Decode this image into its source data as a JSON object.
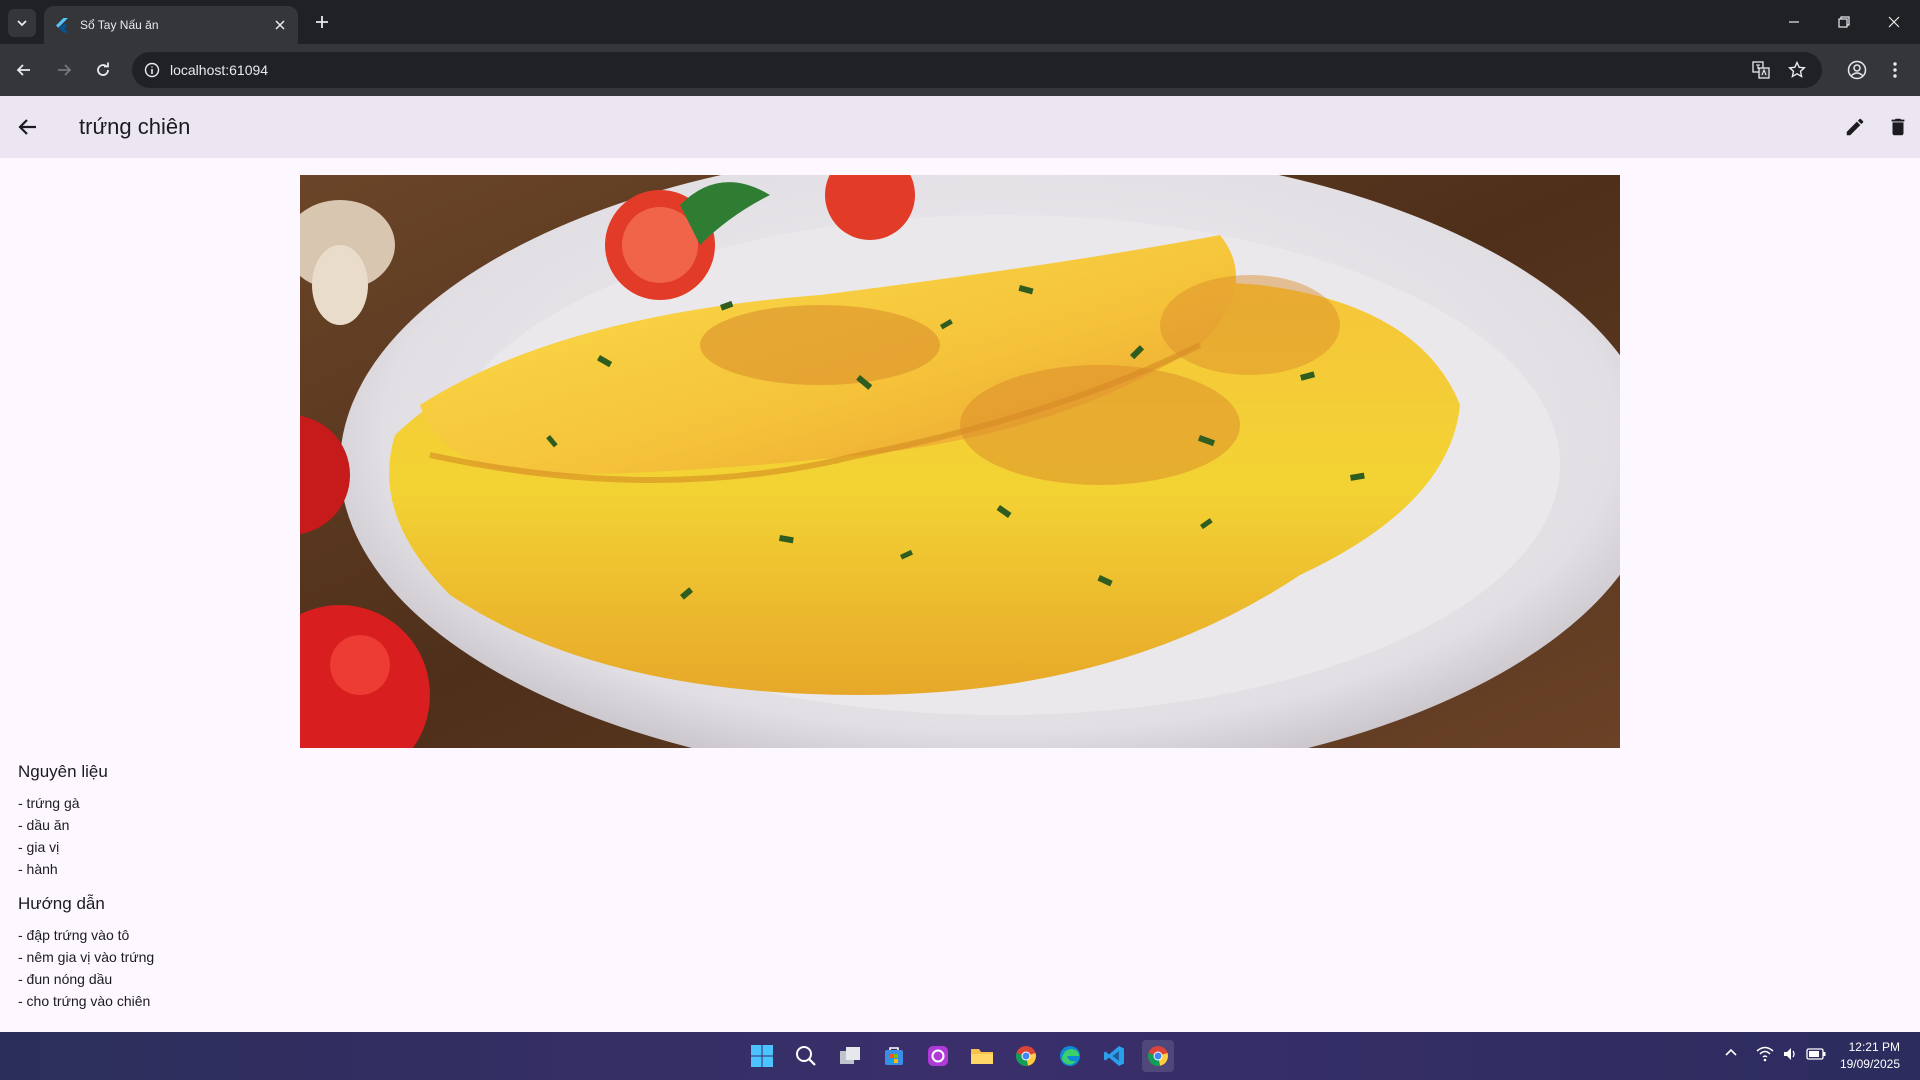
{
  "browser": {
    "tab_title": "Sổ Tay Nấu ăn",
    "url": "localhost:61094"
  },
  "appbar": {
    "title": "trứng chiên"
  },
  "ingredients": {
    "heading": "Nguyên liệu",
    "items": [
      "- trứng gà",
      "- dầu ăn",
      "- gia vị",
      "- hành"
    ]
  },
  "instructions": {
    "heading": "Hướng dẫn",
    "items": [
      "- đập trứng vào tô",
      "- nêm gia vị vào trứng",
      "- đun nóng dầu",
      "- cho trứng vào chiên"
    ]
  },
  "taskbar": {
    "time": "12:21 PM",
    "date": "19/09/2025"
  },
  "colors": {
    "appbar_bg": "#ece6f3",
    "page_bg": "#fdf7ff"
  }
}
